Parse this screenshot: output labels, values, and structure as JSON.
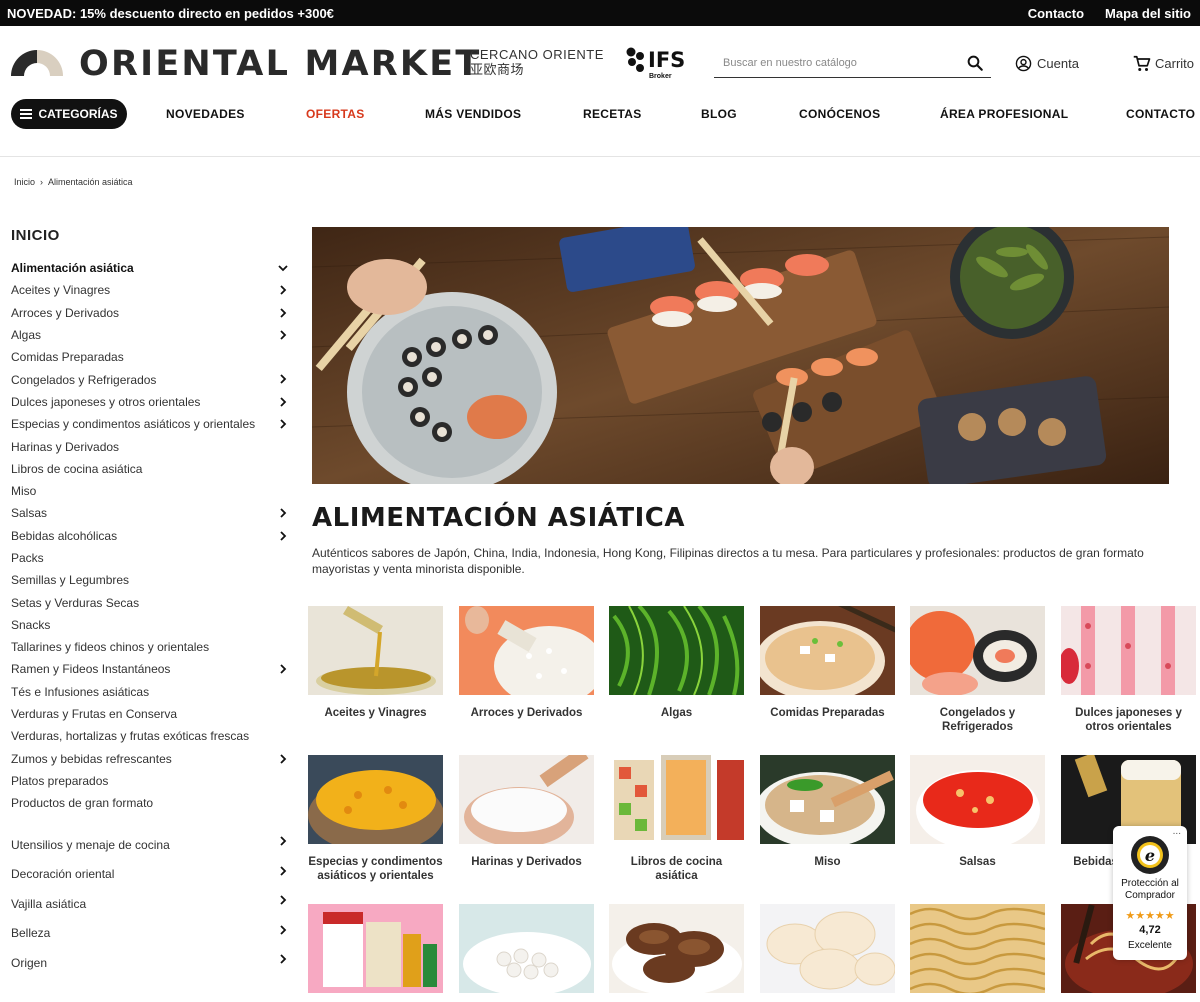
{
  "promo": {
    "message": "NOVEDAD: 15% descuento directo en pedidos +300€",
    "links": [
      "Contacto",
      "Mapa del sitio"
    ]
  },
  "header": {
    "logo": "ORIENTAL MARKET",
    "tagline_1": "CERCANO ORIENTE",
    "tagline_2": "亚欧商场",
    "ifs": "IFS",
    "ifs_sub": "Broker",
    "search_placeholder": "Buscar en nuestro catálogo",
    "account": "Cuenta",
    "cart": "Carrito"
  },
  "nav": {
    "categories_btn": "CATEGORÍAS",
    "items": [
      "NOVEDADES",
      "OFERTAS",
      "MÁS VENDIDOS",
      "RECETAS",
      "BLOG",
      "CONÓCENOS",
      "ÁREA PROFESIONAL",
      "CONTACTO"
    ]
  },
  "breadcrumb": {
    "home": "Inicio",
    "separator": "›",
    "current": "Alimentación asiática"
  },
  "sidebar": {
    "title": "INICIO",
    "items": [
      {
        "label": "Alimentación asiática",
        "active": true,
        "chevron": "down"
      },
      {
        "label": "Aceites y Vinagres",
        "chevron": "right"
      },
      {
        "label": "Arroces y Derivados",
        "chevron": "right"
      },
      {
        "label": "Algas",
        "chevron": "right"
      },
      {
        "label": "Comidas Preparadas",
        "chevron": ""
      },
      {
        "label": "Congelados y Refrigerados",
        "chevron": "right"
      },
      {
        "label": "Dulces japoneses y otros orientales",
        "chevron": "right"
      },
      {
        "label": "Especias y condimentos asiáticos y orientales",
        "chevron": "right"
      },
      {
        "label": "Harinas y Derivados",
        "chevron": ""
      },
      {
        "label": "Libros de cocina asiática",
        "chevron": ""
      },
      {
        "label": "Miso",
        "chevron": ""
      },
      {
        "label": "Salsas",
        "chevron": "right"
      },
      {
        "label": "Bebidas alcohólicas",
        "chevron": "right"
      },
      {
        "label": "Packs",
        "chevron": ""
      },
      {
        "label": "Semillas y Legumbres",
        "chevron": ""
      },
      {
        "label": "Setas y Verduras Secas",
        "chevron": ""
      },
      {
        "label": "Snacks",
        "chevron": ""
      },
      {
        "label": "Tallarines y fideos chinos y orientales",
        "chevron": ""
      },
      {
        "label": "Ramen y Fideos Instantáneos",
        "chevron": "right"
      },
      {
        "label": "Tés e Infusiones asiáticas",
        "chevron": ""
      },
      {
        "label": "Verduras y Frutas en Conserva",
        "chevron": ""
      },
      {
        "label": "Verduras, hortalizas y frutas exóticas frescas",
        "chevron": ""
      },
      {
        "label": "Zumos y bebidas refrescantes",
        "chevron": "right"
      },
      {
        "label": "Platos preparados",
        "chevron": ""
      },
      {
        "label": "Productos de gran formato",
        "chevron": ""
      }
    ],
    "items2": [
      {
        "label": "Utensilios y menaje de cocina",
        "chevron": "right"
      },
      {
        "label": "Decoración oriental",
        "chevron": "right"
      },
      {
        "label": "Vajilla asiática",
        "chevron": "right"
      },
      {
        "label": "Belleza",
        "chevron": "right"
      },
      {
        "label": "Origen",
        "chevron": "right"
      }
    ]
  },
  "main": {
    "title": "ALIMENTACIÓN ASIÁTICA",
    "description": "Auténticos sabores de Japón, China, India, Indonesia, Hong Kong, Filipinas directos a tu mesa. Para particulares y profesionales: productos de gran formato mayoristas y venta minorista disponible.",
    "cards": [
      {
        "label": "Aceites y Vinagres",
        "theme": "oil"
      },
      {
        "label": "Arroces y Derivados",
        "theme": "rice"
      },
      {
        "label": "Algas",
        "theme": "seaweed"
      },
      {
        "label": "Comidas Preparadas",
        "theme": "soup"
      },
      {
        "label": "Congelados y Refrigerados",
        "theme": "sushi"
      },
      {
        "label": "Dulces japoneses y otros orientales",
        "theme": "sweets"
      },
      {
        "label": "Especias y condimentos asiáticos y orientales",
        "theme": "spice"
      },
      {
        "label": "Harinas y Derivados",
        "theme": "flour"
      },
      {
        "label": "Libros de cocina asiática",
        "theme": "books"
      },
      {
        "label": "Miso",
        "theme": "miso"
      },
      {
        "label": "Salsas",
        "theme": "sauce"
      },
      {
        "label": "Bebidas alcohólicas",
        "theme": "beer"
      },
      {
        "label": "",
        "theme": "packs"
      },
      {
        "label": "",
        "theme": "beans"
      },
      {
        "label": "",
        "theme": "mushroom"
      },
      {
        "label": "",
        "theme": "chips"
      },
      {
        "label": "",
        "theme": "noodles"
      },
      {
        "label": "",
        "theme": "ramen"
      }
    ]
  },
  "trust": {
    "menu": "...",
    "line": "Protección al Comprador",
    "stars": "★★★★★",
    "rating": "4,72",
    "label": "Excelente"
  },
  "colors": {
    "accent": "#d7391c",
    "dark": "#111111",
    "star": "#f09a16"
  }
}
